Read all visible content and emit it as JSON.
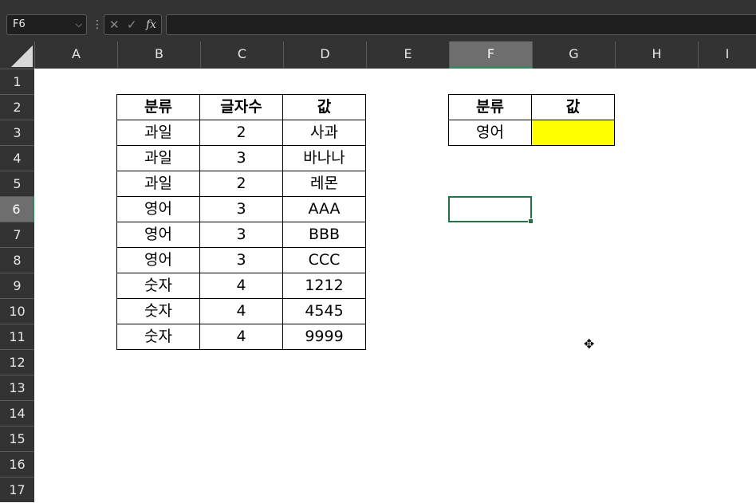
{
  "formula_bar": {
    "name_box": "F6",
    "formula": "",
    "fx_label": "fx"
  },
  "columns": [
    "A",
    "B",
    "C",
    "D",
    "E",
    "F",
    "G",
    "H",
    "I"
  ],
  "rows": [
    "1",
    "2",
    "3",
    "4",
    "5",
    "6",
    "7",
    "8",
    "9",
    "10",
    "11",
    "12",
    "13",
    "14",
    "15",
    "16",
    "17"
  ],
  "selected": {
    "column": "F",
    "row": "6"
  },
  "main_table": {
    "headers": [
      "분류",
      "글자수",
      "값"
    ],
    "rows": [
      [
        "과일",
        "2",
        "사과"
      ],
      [
        "과일",
        "3",
        "바나나"
      ],
      [
        "과일",
        "2",
        "레몬"
      ],
      [
        "영어",
        "3",
        "AAA"
      ],
      [
        "영어",
        "3",
        "BBB"
      ],
      [
        "영어",
        "3",
        "CCC"
      ],
      [
        "숫자",
        "4",
        "1212"
      ],
      [
        "숫자",
        "4",
        "4545"
      ],
      [
        "숫자",
        "4",
        "9999"
      ]
    ]
  },
  "lookup_table": {
    "headers": [
      "분류",
      "값"
    ],
    "row": [
      "영어",
      ""
    ]
  },
  "colors": {
    "header_bg": "#333333",
    "selected_accent": "#217346",
    "highlight_fill": "#ffff00"
  }
}
